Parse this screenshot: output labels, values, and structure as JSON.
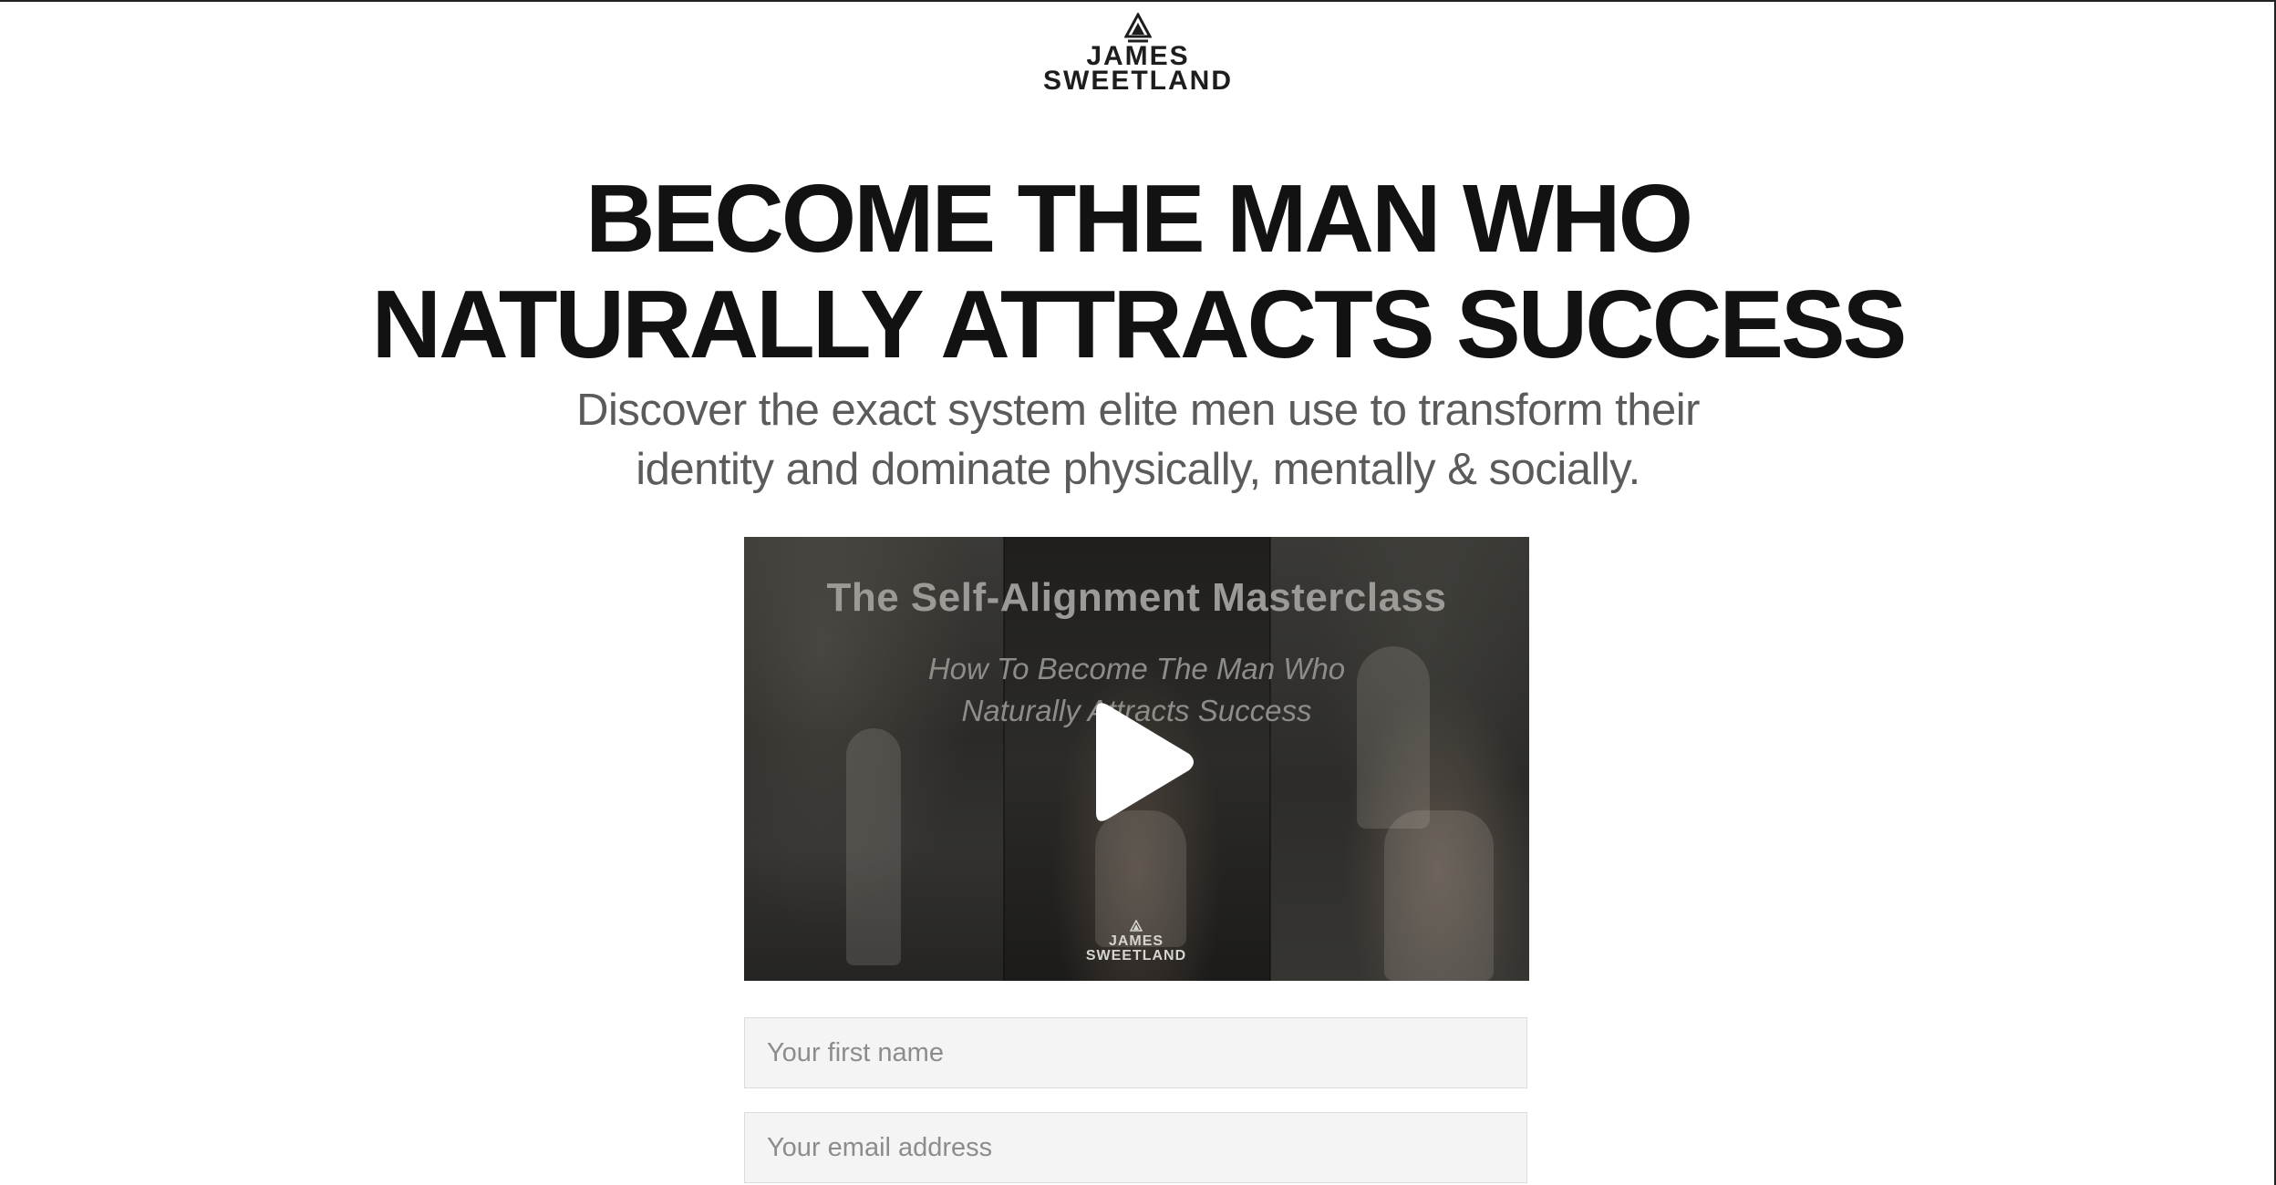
{
  "logo": {
    "line1": "JAMES",
    "line2": "SWEETLAND",
    "icon": "triangle-monogram-icon"
  },
  "hero": {
    "headline_line1": "BECOME THE MAN WHO",
    "headline_line2": "NATURALLY ATTRACTS SUCCESS",
    "subhead_line1": "Discover the exact system elite men use to transform their",
    "subhead_line2": "identity and dominate physically, mentally & socially."
  },
  "video": {
    "title": "The Self-Alignment Masterclass",
    "subtitle_line1": "How To Become The Man Who",
    "subtitle_line2": "Naturally Attracts Success",
    "play_icon": "play-icon",
    "watermark_line1": "JAMES",
    "watermark_line2": "SWEETLAND"
  },
  "form": {
    "first_name_placeholder": "Your first name",
    "email_placeholder": "Your email address",
    "first_name_value": "",
    "email_value": ""
  },
  "colors": {
    "headline": "#121212",
    "subhead": "#5b5b5b",
    "field_bg": "#f4f4f4",
    "field_border": "#dcdcdc"
  }
}
